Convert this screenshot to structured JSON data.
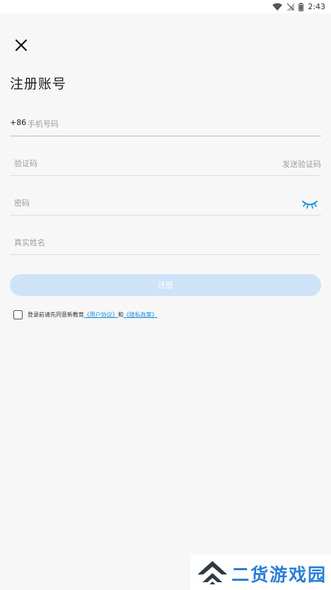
{
  "status_bar": {
    "time": "2:43",
    "icons": [
      "wifi-icon",
      "no-signal-icon",
      "battery-icon"
    ]
  },
  "header": {
    "close_icon": "close-icon",
    "title": "注册账号"
  },
  "form": {
    "phone": {
      "prefix": "+86",
      "placeholder": "手机号码"
    },
    "code": {
      "placeholder": "验证码",
      "send_label": "发送验证码"
    },
    "password": {
      "placeholder": "密码",
      "toggle_icon": "eye-closed-icon"
    },
    "real_name": {
      "placeholder": "真实姓名"
    },
    "submit_label": "注册"
  },
  "agreement": {
    "text": "登录前请先同意新教育",
    "link_user": "《用户协议》",
    "joiner": "和",
    "link_privacy": "《隐私政策》"
  },
  "watermark": {
    "text": "二货游戏园"
  },
  "colors": {
    "accent": "#1a8fe0",
    "button_disabled": "#cfe3f8",
    "background": "#f7f7f7",
    "watermark": "#2a7fd6"
  }
}
